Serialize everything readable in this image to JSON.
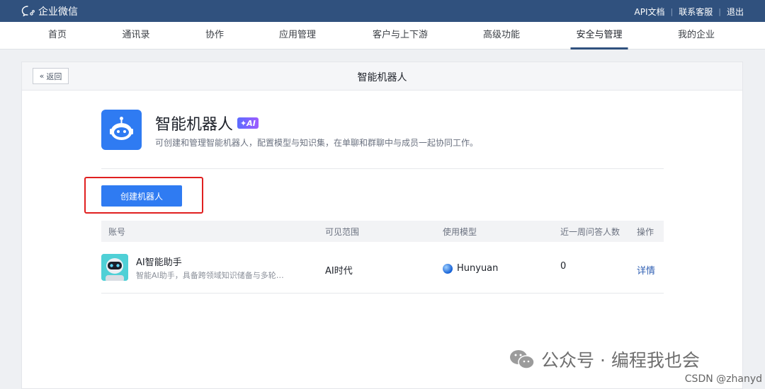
{
  "topbar": {
    "brand": "企业微信",
    "links": [
      "API文档",
      "联系客服",
      "退出"
    ]
  },
  "nav": {
    "items": [
      "首页",
      "通讯录",
      "协作",
      "应用管理",
      "客户与上下游",
      "高级功能",
      "安全与管理",
      "我的企业"
    ],
    "active": "安全与管理"
  },
  "page": {
    "back_label": "返回",
    "title": "智能机器人"
  },
  "app": {
    "name": "智能机器人",
    "badge": "AI",
    "description": "可创建和管理智能机器人，配置模型与知识集，在单聊和群聊中与成员一起协同工作。",
    "icon": "robot-icon",
    "accent_color": "#2f7bf2"
  },
  "actions": {
    "create_label": "创建机器人"
  },
  "table": {
    "columns": [
      "账号",
      "可见范围",
      "使用模型",
      "近一周问答人数",
      "操作"
    ],
    "rows": [
      {
        "name": "AI智能助手",
        "description": "智能AI助手，具备跨领域知识储备与多轮…",
        "scope": "AI时代",
        "model": "Hunyuan",
        "weekly_users": "0",
        "action": "详情"
      }
    ]
  },
  "watermark": {
    "text": "公众号 · 编程我也会",
    "csdn": "CSDN @zhanyd"
  }
}
